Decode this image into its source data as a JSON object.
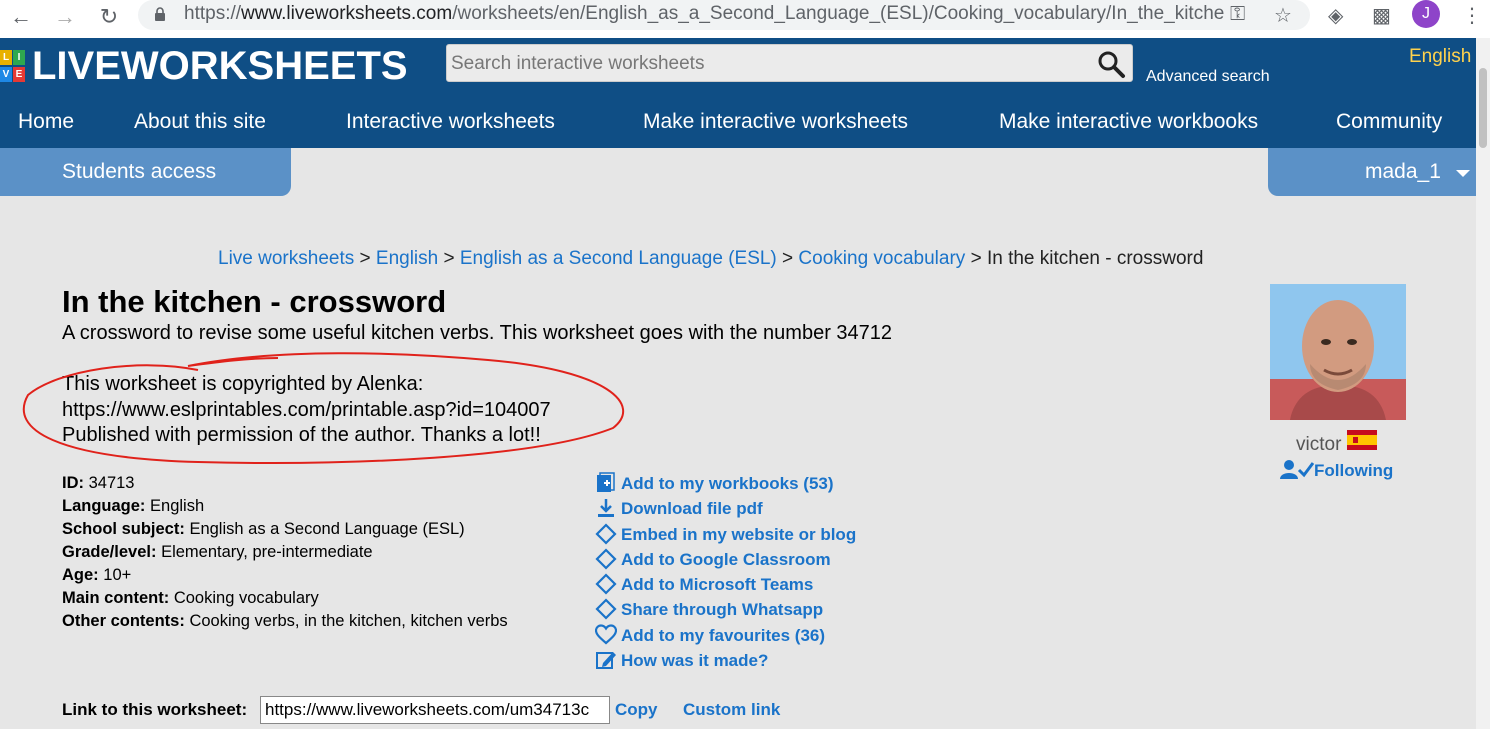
{
  "browser": {
    "url_prefix": "https://",
    "url_host": "www.liveworksheets.com",
    "url_path": "/worksheets/en/English_as_a_Second_Language_(ESL)/Cooking_vocabulary/In_the_kitche...",
    "profile_initial": "J"
  },
  "header": {
    "logo_text": "LIVEWORKSHEETS",
    "logo_blocks": [
      "L",
      "I",
      "V",
      "E"
    ],
    "search_placeholder": "Search interactive worksheets",
    "advanced_search": "Advanced search",
    "language": "English",
    "menu": [
      "Home",
      "About this site",
      "Interactive worksheets",
      "Make interactive worksheets",
      "Make interactive workbooks",
      "Community"
    ],
    "students_access": "Students access",
    "username": "mada_1"
  },
  "breadcrumb": {
    "items": [
      "Live worksheets",
      "English",
      "English as a Second Language (ESL)",
      "Cooking vocabulary"
    ],
    "separator": " > ",
    "current": "In the kitchen - crossword"
  },
  "worksheet": {
    "title": "In the kitchen - crossword",
    "description": "A crossword to revise some useful kitchen verbs. This worksheet goes with the number 34712",
    "copyright_lines": [
      "This worksheet is copyrighted by Alenka:",
      "https://www.eslprintables.com/printable.asp?id=104007",
      "Published with permission of the author. Thanks a lot!!"
    ]
  },
  "info": [
    {
      "label": "ID:",
      "value": "34713"
    },
    {
      "label": "Language:",
      "value": "English"
    },
    {
      "label": "School subject:",
      "value": "English as a Second Language (ESL)"
    },
    {
      "label": "Grade/level:",
      "value": "Elementary, pre-intermediate"
    },
    {
      "label": "Age:",
      "value": "10+"
    },
    {
      "label": "Main content:",
      "value": "Cooking vocabulary"
    },
    {
      "label": "Other contents:",
      "value": "Cooking verbs, in the kitchen, kitchen verbs"
    }
  ],
  "actions": [
    {
      "label": "Add to my workbooks (53)",
      "icon": "add-to-workbook-icon"
    },
    {
      "label": "Download file pdf",
      "icon": "download-icon"
    },
    {
      "label": "Embed in my website or blog",
      "icon": "embed-icon"
    },
    {
      "label": "Add to Google Classroom",
      "icon": "embed-icon"
    },
    {
      "label": "Add to Microsoft Teams",
      "icon": "embed-icon"
    },
    {
      "label": "Share through Whatsapp",
      "icon": "embed-icon"
    },
    {
      "label": "Add to my favourites (36)",
      "icon": "heart-icon"
    },
    {
      "label": "How was it made?",
      "icon": "edit-icon"
    }
  ],
  "author": {
    "name": "victor",
    "following_label": "Following"
  },
  "link_row": {
    "label": "Link to this worksheet:",
    "value": "https://www.liveworksheets.com/um34713c",
    "copy": "Copy",
    "custom": "Custom link"
  },
  "colors": {
    "header_bg": "#0f4e85",
    "tab_bg": "#5b91c7",
    "link": "#1a73c9",
    "annotation": "#e0221b"
  }
}
